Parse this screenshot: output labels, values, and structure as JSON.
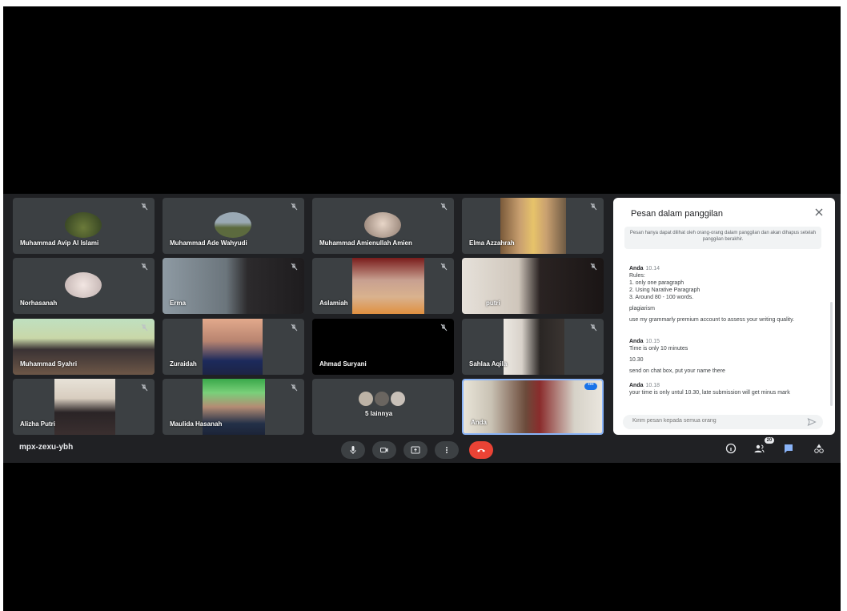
{
  "meeting": {
    "code": "mpx-zexu-ybh",
    "participant_count": "20"
  },
  "participants": [
    {
      "name": "Muhammad Avip Al Islami"
    },
    {
      "name": "Muhammad Ade Wahyudi"
    },
    {
      "name": "Muhammad Amienullah Amien"
    },
    {
      "name": "Elma Azzahrah"
    },
    {
      "name": "Norhasanah"
    },
    {
      "name": "Erma"
    },
    {
      "name": "Aslamiah"
    },
    {
      "name": "putri"
    },
    {
      "name": "Muhammad Syahri"
    },
    {
      "name": "Zuraidah"
    },
    {
      "name": "Ahmad Suryani"
    },
    {
      "name": "Sahlaa Aqila"
    },
    {
      "name": "Alizha Putri"
    },
    {
      "name": "Maulida Hasanah"
    },
    {
      "name": "5 lainnya"
    },
    {
      "name": "Anda"
    }
  ],
  "chat": {
    "title": "Pesan dalam panggilan",
    "notice": "Pesan hanya dapat dilihat oleh orang-orang dalam panggilan dan akan dihapus setelah panggilan berakhir.",
    "messages": [
      {
        "sender": "Anda",
        "time": "10.14",
        "lines": [
          "Rules:",
          "1. only one paragraph",
          "2. Using Narative Paragraph",
          "3. Around 80 - 100 words.",
          "plagiarism",
          "use my grammarly premium account to assess your writing quality."
        ]
      },
      {
        "sender": "Anda",
        "time": "10.15",
        "lines": [
          "Time is only 10 minutes",
          "10.30",
          "send on chat box, put your name there"
        ]
      },
      {
        "sender": "Anda",
        "time": "10.18",
        "lines": [
          "your time is only untul 10.30, late submission will get minus mark"
        ]
      }
    ],
    "input_placeholder": "Kirim pesan kepada semua orang"
  },
  "colors": {
    "background": "#202124",
    "tile": "#3c4043",
    "hangup": "#ea4335",
    "chat_active": "#8ab4f8",
    "self_border": "#8ab4f8"
  }
}
